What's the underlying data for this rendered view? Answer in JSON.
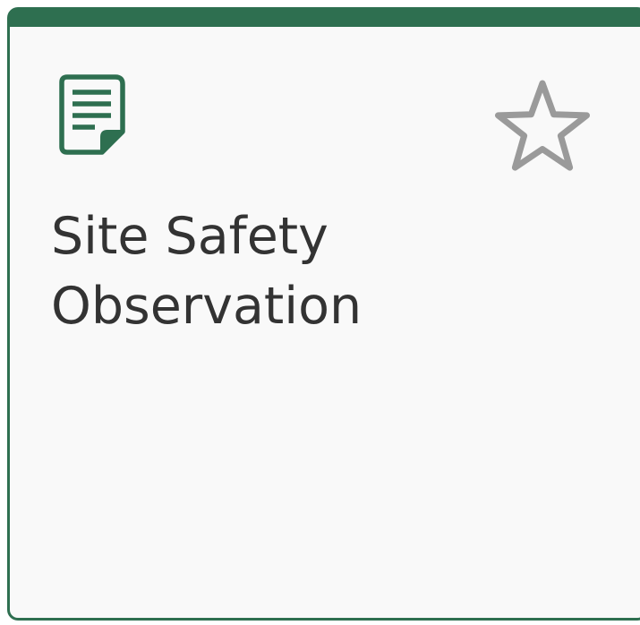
{
  "card": {
    "title": "Site Safety\nObservation",
    "icon": "document-icon",
    "favorite_icon": "star-outline-icon",
    "favorited": false
  },
  "colors": {
    "accent": "#2e6f50",
    "card_background": "#f9f9f9",
    "title_text": "#333333",
    "star_outline": "#9a9a9a"
  }
}
